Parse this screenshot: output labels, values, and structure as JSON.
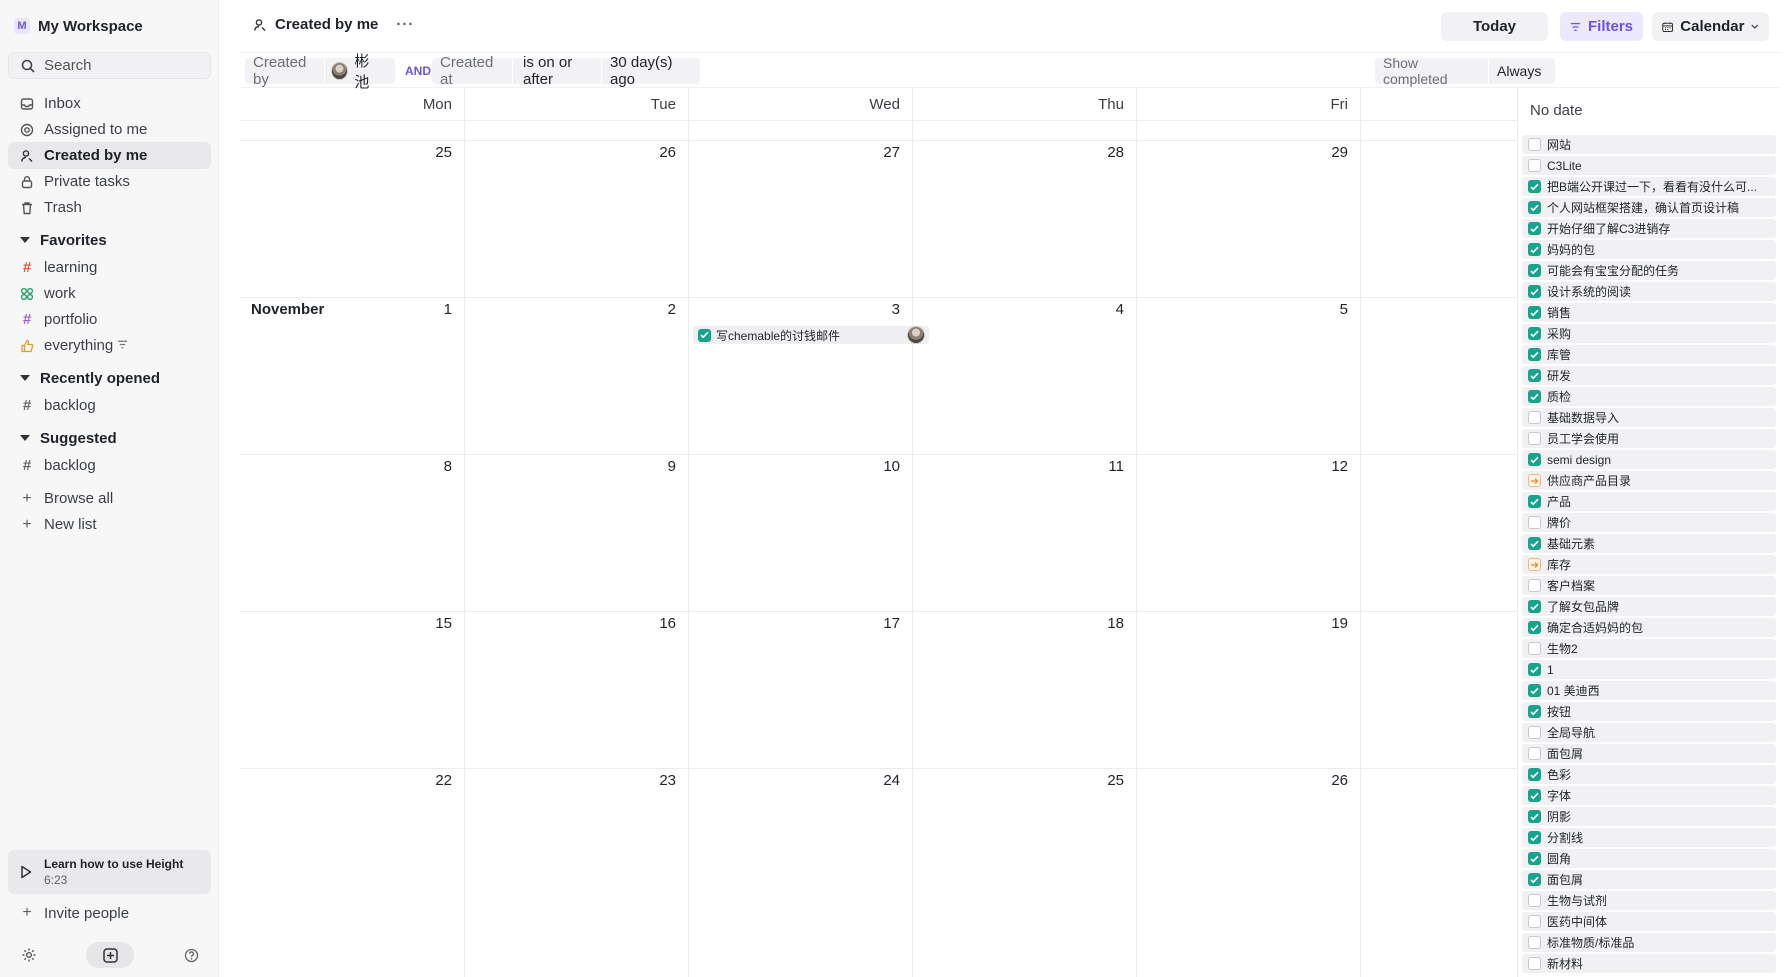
{
  "workspace": {
    "badge": "M",
    "name": "My Workspace"
  },
  "search": {
    "placeholder": "Search"
  },
  "nav": [
    {
      "label": "Inbox",
      "icon": "inbox-icon"
    },
    {
      "label": "Assigned to me",
      "icon": "target-icon"
    },
    {
      "label": "Created by me",
      "icon": "user-icon",
      "active": true
    },
    {
      "label": "Private tasks",
      "icon": "lock-icon"
    },
    {
      "label": "Trash",
      "icon": "trash-icon"
    }
  ],
  "favorites": {
    "title": "Favorites",
    "items": [
      {
        "label": "learning",
        "color": "#e5533d"
      },
      {
        "label": "work",
        "color": "#2fa56a"
      },
      {
        "label": "portfolio",
        "color": "#a25ddc"
      },
      {
        "label": "everything",
        "color": "#e0a020"
      }
    ]
  },
  "recent": {
    "title": "Recently opened",
    "items": [
      {
        "label": "backlog"
      }
    ]
  },
  "suggested": {
    "title": "Suggested",
    "items": [
      {
        "label": "backlog"
      }
    ]
  },
  "actions": {
    "browse_all": "Browse all",
    "new_list": "New list"
  },
  "learn": {
    "title": "Learn how to use Height",
    "duration": "6:23"
  },
  "invite": "Invite people",
  "page": {
    "title": "Created by me",
    "more": "···"
  },
  "toolbar": {
    "today": "Today",
    "filters": "Filters",
    "view": "Calendar"
  },
  "filter": {
    "created_by": "Created by",
    "user": "彬 池",
    "and": "AND",
    "created_at": "Created at",
    "operator": "is on or after",
    "value": "30 day(s) ago",
    "show_completed": "Show completed",
    "show_completed_value": "Always"
  },
  "calendar": {
    "days": [
      "Mon",
      "Tue",
      "Wed",
      "Thu",
      "Fri"
    ],
    "weeks": [
      {
        "month": "",
        "dates": [
          "25",
          "26",
          "27",
          "28",
          "29"
        ]
      },
      {
        "month": "November",
        "dates": [
          "1",
          "2",
          "3",
          "4",
          "5"
        ]
      },
      {
        "month": "",
        "dates": [
          "8",
          "9",
          "10",
          "11",
          "12"
        ]
      },
      {
        "month": "",
        "dates": [
          "15",
          "16",
          "17",
          "18",
          "19"
        ]
      },
      {
        "month": "",
        "dates": [
          "22",
          "23",
          "24",
          "25",
          "26"
        ]
      }
    ],
    "event": {
      "title": "写chemable的讨钱邮件",
      "done": true
    }
  },
  "no_date": {
    "title": "No date",
    "tasks": [
      {
        "t": "网站",
        "s": "todo"
      },
      {
        "t": "C3Lite",
        "s": "todo"
      },
      {
        "t": "把B端公开课过一下，看看有没什么可...",
        "s": "done"
      },
      {
        "t": "个人网站框架搭建，确认首页设计稿",
        "s": "done"
      },
      {
        "t": "开始仔细了解C3进销存",
        "s": "done"
      },
      {
        "t": "妈妈的包",
        "s": "done"
      },
      {
        "t": "可能会有宝宝分配的任务",
        "s": "done"
      },
      {
        "t": "设计系统的阅读",
        "s": "done"
      },
      {
        "t": "销售",
        "s": "done"
      },
      {
        "t": "采购",
        "s": "done"
      },
      {
        "t": "库管",
        "s": "done"
      },
      {
        "t": "研发",
        "s": "done"
      },
      {
        "t": "质检",
        "s": "done"
      },
      {
        "t": "基础数据导入",
        "s": "todo"
      },
      {
        "t": "员工学会使用",
        "s": "todo"
      },
      {
        "t": "semi design",
        "s": "done"
      },
      {
        "t": "供应商产品目录",
        "s": "prog"
      },
      {
        "t": "产品",
        "s": "done"
      },
      {
        "t": "牌价",
        "s": "todo"
      },
      {
        "t": "基础元素",
        "s": "done"
      },
      {
        "t": "库存",
        "s": "prog"
      },
      {
        "t": "客户档案",
        "s": "todo"
      },
      {
        "t": "了解女包品牌",
        "s": "done"
      },
      {
        "t": "确定合适妈妈的包",
        "s": "done"
      },
      {
        "t": "生物2",
        "s": "todo"
      },
      {
        "t": "1",
        "s": "done"
      },
      {
        "t": "01 美迪西",
        "s": "done"
      },
      {
        "t": "按钮",
        "s": "done"
      },
      {
        "t": "全局导航",
        "s": "todo"
      },
      {
        "t": "面包屑",
        "s": "todo"
      },
      {
        "t": "色彩",
        "s": "done"
      },
      {
        "t": "字体",
        "s": "done"
      },
      {
        "t": "阴影",
        "s": "done"
      },
      {
        "t": "分割线",
        "s": "done"
      },
      {
        "t": "圆角",
        "s": "done"
      },
      {
        "t": "面包屑",
        "s": "done"
      },
      {
        "t": "生物与试剂",
        "s": "todo"
      },
      {
        "t": "医药中间体",
        "s": "todo"
      },
      {
        "t": "标准物质/标准品",
        "s": "todo"
      },
      {
        "t": "新材料",
        "s": "todo"
      }
    ]
  }
}
